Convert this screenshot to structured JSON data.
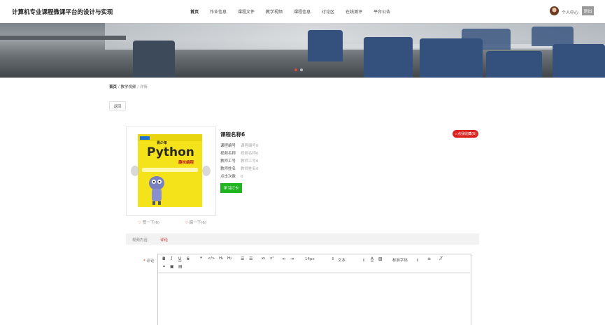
{
  "header": {
    "site_title": "计算机专业课程微课平台的设计与实现",
    "nav": [
      "首页",
      "作业信息",
      "课程文件",
      "教学视频",
      "课程信息",
      "讨论区",
      "在线测评",
      "平台公告"
    ],
    "user_link": "个人中心",
    "logout": "退出"
  },
  "breadcrumb": {
    "home": "首页",
    "section": "教学视频",
    "current": "详情",
    "separator": "/"
  },
  "back_label": "返回",
  "product": {
    "cover_small": "青少年",
    "cover_title": "Python",
    "cover_subtitle": "趣味编程",
    "course_name": "课程名称6",
    "favorite_label": "☆点我收藏(6)",
    "fields": [
      {
        "label": "课程编号",
        "value": "课程编号6"
      },
      {
        "label": "视频名称",
        "value": "视频名称6"
      },
      {
        "label": "教师工号",
        "value": "教师工号6"
      },
      {
        "label": "教师姓名",
        "value": "教师姓名6"
      },
      {
        "label": "点击次数",
        "value": "6"
      }
    ],
    "study_button": "学习打卡",
    "like": "赞一下(6)",
    "dislike": "踩一下(6)"
  },
  "tabs": [
    "视频内容",
    "评论"
  ],
  "comment": {
    "required_mark": "*",
    "label": "评论",
    "toolbar": {
      "size": "14px",
      "format": "文本",
      "font": "标准字体"
    }
  },
  "colors": {
    "accent": "#d9231f",
    "study": "#21b421",
    "banner_seat": "#34507d"
  }
}
